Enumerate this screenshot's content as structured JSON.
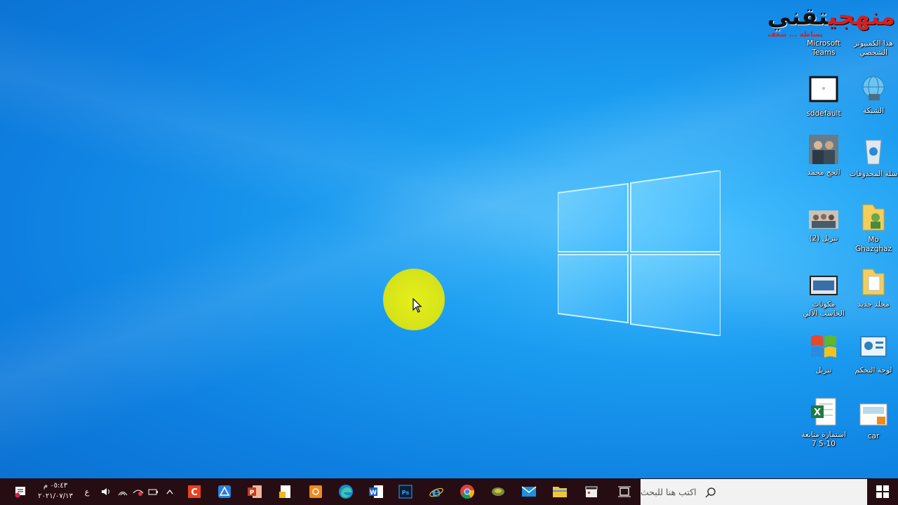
{
  "watermark": {
    "title_part1": "منهجي",
    "title_part2": "تقني",
    "tagline": "بساطة ... شغف"
  },
  "desktop_icons": [
    {
      "id": "this-pc",
      "label": "هذا الكمبيوتر الشخصي"
    },
    {
      "id": "teams",
      "label": "Microsoft Teams"
    },
    {
      "id": "network",
      "label": "الشبكة"
    },
    {
      "id": "sddefault",
      "label": "sddefault"
    },
    {
      "id": "recycle",
      "label": "سلة المحذوفات"
    },
    {
      "id": "haj",
      "label": "الحج محمد"
    },
    {
      "id": "mo",
      "label": "Mo Ghazghaz"
    },
    {
      "id": "download2",
      "label": "تنزيل (2)"
    },
    {
      "id": "newfolder",
      "label": "مجلد جديد"
    },
    {
      "id": "components",
      "label": "مكونات الحاسب الآلي"
    },
    {
      "id": "controlpanel",
      "label": "لوحة التحكم"
    },
    {
      "id": "download",
      "label": "تنزيل"
    },
    {
      "id": "car",
      "label": "car"
    },
    {
      "id": "excelfile",
      "label": "استمارة متابعة 10-5 7"
    }
  ],
  "taskbar": {
    "search_placeholder": "اكتب هنا للبحث",
    "time": "٠٥:٤٣ م",
    "date": "٢٠٢١/٠٧/١٣",
    "language": "ع",
    "apps": [
      "task-view",
      "claquette",
      "file-explorer",
      "mail",
      "office-hub",
      "chrome",
      "internet-explorer",
      "photoshop",
      "word",
      "edge",
      "snip-sketch",
      "package",
      "powerpoint",
      "app-blue",
      "app-orange"
    ]
  },
  "colors": {
    "taskbar_bg": "#260d14",
    "desktop_bg": "#1a9bf0",
    "cursor_highlight": "#dde61a"
  }
}
